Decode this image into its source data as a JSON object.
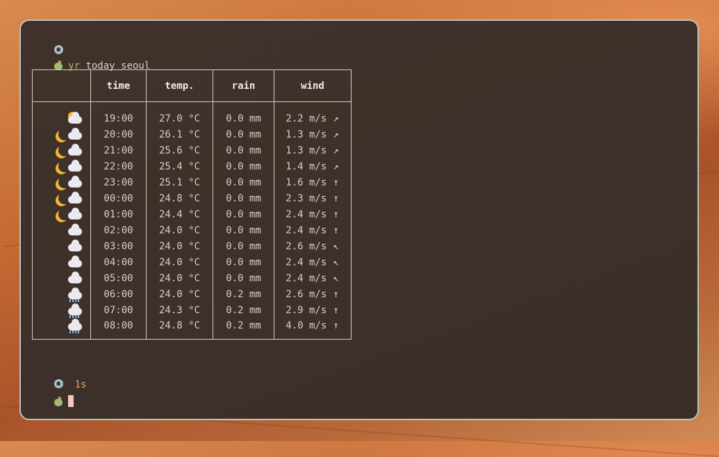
{
  "prompt": {
    "home_icon": "home-icon",
    "apple_icon": "apple-icon",
    "command": "yr",
    "args": " today seoul",
    "duration": "1s"
  },
  "table": {
    "headers": [
      "",
      "time",
      "temp.",
      "rain",
      "wind"
    ],
    "rows": [
      {
        "icon": "sun-behind-cloud",
        "time": "19:00",
        "temp": "27.0 °C",
        "rain": "0.0 mm",
        "wind": "2.2 m/s",
        "dir": "↗"
      },
      {
        "icon": "moon-cloud",
        "time": "20:00",
        "temp": "26.1 °C",
        "rain": "0.0 mm",
        "wind": "1.3 m/s",
        "dir": "↗"
      },
      {
        "icon": "moon-cloud",
        "time": "21:00",
        "temp": "25.6 °C",
        "rain": "0.0 mm",
        "wind": "1.3 m/s",
        "dir": "↗"
      },
      {
        "icon": "moon-cloud",
        "time": "22:00",
        "temp": "25.4 °C",
        "rain": "0.0 mm",
        "wind": "1.4 m/s",
        "dir": "↗"
      },
      {
        "icon": "moon-cloud",
        "time": "23:00",
        "temp": "25.1 °C",
        "rain": "0.0 mm",
        "wind": "1.6 m/s",
        "dir": "↑"
      },
      {
        "icon": "moon-cloud",
        "time": "00:00",
        "temp": "24.8 °C",
        "rain": "0.0 mm",
        "wind": "2.3 m/s",
        "dir": "↑"
      },
      {
        "icon": "moon-cloud",
        "time": "01:00",
        "temp": "24.4 °C",
        "rain": "0.0 mm",
        "wind": "2.4 m/s",
        "dir": "↑"
      },
      {
        "icon": "cloud",
        "time": "02:00",
        "temp": "24.0 °C",
        "rain": "0.0 mm",
        "wind": "2.4 m/s",
        "dir": "↑"
      },
      {
        "icon": "cloud",
        "time": "03:00",
        "temp": "24.0 °C",
        "rain": "0.0 mm",
        "wind": "2.6 m/s",
        "dir": "↖"
      },
      {
        "icon": "cloud",
        "time": "04:00",
        "temp": "24.0 °C",
        "rain": "0.0 mm",
        "wind": "2.4 m/s",
        "dir": "↖"
      },
      {
        "icon": "cloud",
        "time": "05:00",
        "temp": "24.0 °C",
        "rain": "0.0 mm",
        "wind": "2.4 m/s",
        "dir": "↖"
      },
      {
        "icon": "cloud-rain",
        "time": "06:00",
        "temp": "24.0 °C",
        "rain": "0.2 mm",
        "wind": "2.6 m/s",
        "dir": "↑"
      },
      {
        "icon": "cloud-rain",
        "time": "07:00",
        "temp": "24.3 °C",
        "rain": "0.2 mm",
        "wind": "2.9 m/s",
        "dir": "↑"
      },
      {
        "icon": "cloud-rain",
        "time": "08:00",
        "temp": "24.8 °C",
        "rain": "0.2 mm",
        "wind": "4.0 m/s",
        "dir": "↑"
      }
    ]
  },
  "colors": {
    "terminal_bg": "#3d302a",
    "border": "#b9c6bd",
    "command": "#a4b96a",
    "duration": "#e7a35e",
    "cursor": "#f2c9c0"
  }
}
